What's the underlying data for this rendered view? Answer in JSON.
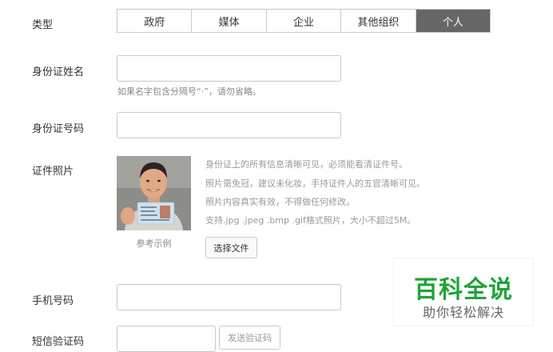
{
  "type_row": {
    "label": "类型",
    "options": [
      "政府",
      "媒体",
      "企业",
      "其他组织",
      "个人"
    ],
    "selected": "个人"
  },
  "id_name": {
    "label": "身份证姓名",
    "value": "",
    "hint": "如果名字包含分隔号“·”，请勿省略。"
  },
  "id_number": {
    "label": "身份证号码",
    "value": ""
  },
  "id_photo": {
    "label": "证件照片",
    "example_caption": "参考示例",
    "requirements": [
      "身份证上的所有信息清晰可见，必须能看清证件号。",
      "照片需免冠，建议未化妆，手持证件人的五官清晰可见。",
      "照片内容真实有效，不得做任何修改。",
      "支持.jpg .jpeg .bmp .gif格式照片，大小不超过5M。"
    ],
    "choose_file_label": "选择文件"
  },
  "phone": {
    "label": "手机号码",
    "value": ""
  },
  "sms_code": {
    "label": "短信验证码",
    "value": "",
    "send_label": "发送验证码"
  },
  "watermark": {
    "main": "百科全说",
    "sub": "助你轻松解决",
    "color": "#1fa33a"
  },
  "colors": {
    "tab_active_bg": "#666666",
    "border": "#c9c9c9",
    "hint_text": "#888888"
  }
}
